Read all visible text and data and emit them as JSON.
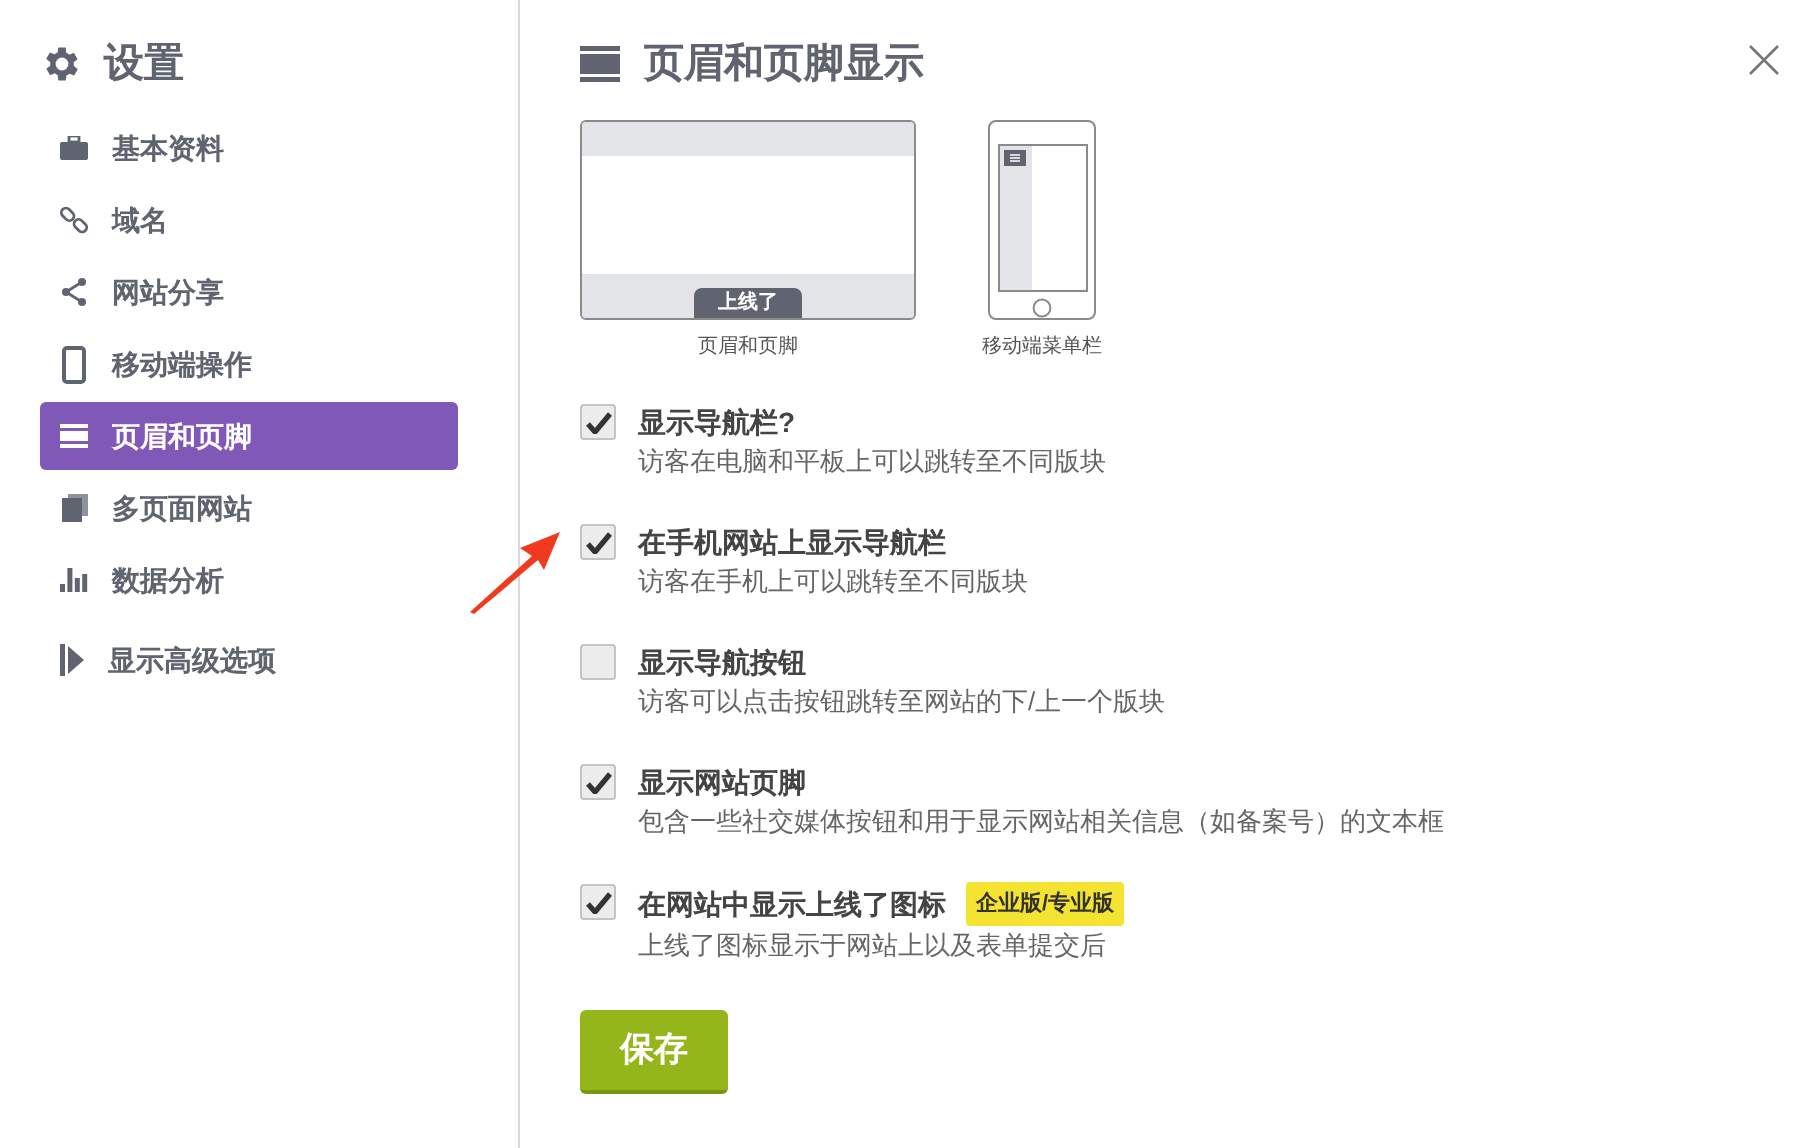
{
  "sidebar": {
    "title": "设置",
    "items": [
      {
        "label": "基本资料",
        "selected": false
      },
      {
        "label": "域名",
        "selected": false
      },
      {
        "label": "网站分享",
        "selected": false
      },
      {
        "label": "移动端操作",
        "selected": false
      },
      {
        "label": "页眉和页脚",
        "selected": true
      },
      {
        "label": "多页面网站",
        "selected": false
      },
      {
        "label": "数据分析",
        "selected": false
      }
    ],
    "advanced": "显示高级选项"
  },
  "panel": {
    "title": "页眉和页脚显示",
    "previews": [
      {
        "kind": "desktop",
        "badge": "上线了",
        "caption": "页眉和页脚"
      },
      {
        "kind": "phone",
        "caption": "移动端菜单栏"
      }
    ],
    "options": [
      {
        "title": "显示导航栏?",
        "description": "访客在电脑和平板上可以跳转至不同版块",
        "checked": true
      },
      {
        "title": "在手机网站上显示导航栏",
        "description": "访客在手机上可以跳转至不同版块",
        "checked": true
      },
      {
        "title": "显示导航按钮",
        "description": "访客可以点击按钮跳转至网站的下/上一个版块",
        "checked": false
      },
      {
        "title": "显示网站页脚",
        "description": "包含一些社交媒体按钮和用于显示网站相关信息（如备案号）的文本框",
        "checked": true
      },
      {
        "title": "在网站中显示上线了图标",
        "badge": "企业版/专业版",
        "description": "上线了图标显示于网站上以及表单提交后",
        "checked": true
      }
    ],
    "save": "保存"
  }
}
